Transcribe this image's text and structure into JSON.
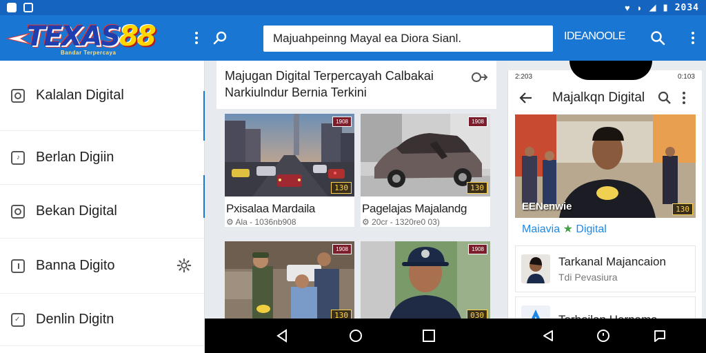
{
  "status_bar": {
    "time": "2034"
  },
  "app_bar": {
    "logo_text_a": "TEXAS",
    "logo_text_b": "88",
    "logo_subtext": "Bandar Terpercaya",
    "search_value": "Majuahpeinng Mayal ea Diora Sianl.",
    "right_label": "IDEANOOLE"
  },
  "drawer": {
    "items": [
      {
        "label": "Kalalan Digital"
      },
      {
        "label": "Berlan Digiin"
      },
      {
        "label": "Bekan Digital"
      },
      {
        "label": "Banna Digito"
      },
      {
        "label": "Denlin Digitn"
      }
    ]
  },
  "feed": {
    "header_title": "Majugan Digital Terpercayah Calbakai",
    "header_subtitle": "Narkiulndur Bernia Terkini",
    "cards": [
      {
        "title": "Pxisalaa Mardaila",
        "meta": "Ala - 1036nb908",
        "badge_top": "1908",
        "badge_bot": "130"
      },
      {
        "title": "Pagelajas Majalandg",
        "meta": "20cr - 1320re0 03)",
        "badge_top": "1908",
        "badge_bot": "130"
      },
      {
        "title": "",
        "meta": "",
        "badge_top": "1908",
        "badge_bot": "130"
      },
      {
        "title": "",
        "meta": "",
        "badge_top": "1908",
        "badge_bot": "030"
      }
    ]
  },
  "phone": {
    "status_left": "2:203",
    "status_right": "0:103",
    "title": "Majalkqn Digital",
    "feature_overlay": "EENenwie",
    "feature_badge": "130",
    "feature_caption_a": "Maiavia",
    "feature_caption_star": "★",
    "feature_caption_b": "Digital",
    "items": [
      {
        "title": "Tarkanal Majancaion",
        "sub": "Tdi Pevasiura"
      },
      {
        "title": "Terbojlan Hernama",
        "sub": ""
      }
    ]
  },
  "colors": {
    "appbar": "#1976d2",
    "status": "#1565c0",
    "accent": "#1e88e5"
  }
}
